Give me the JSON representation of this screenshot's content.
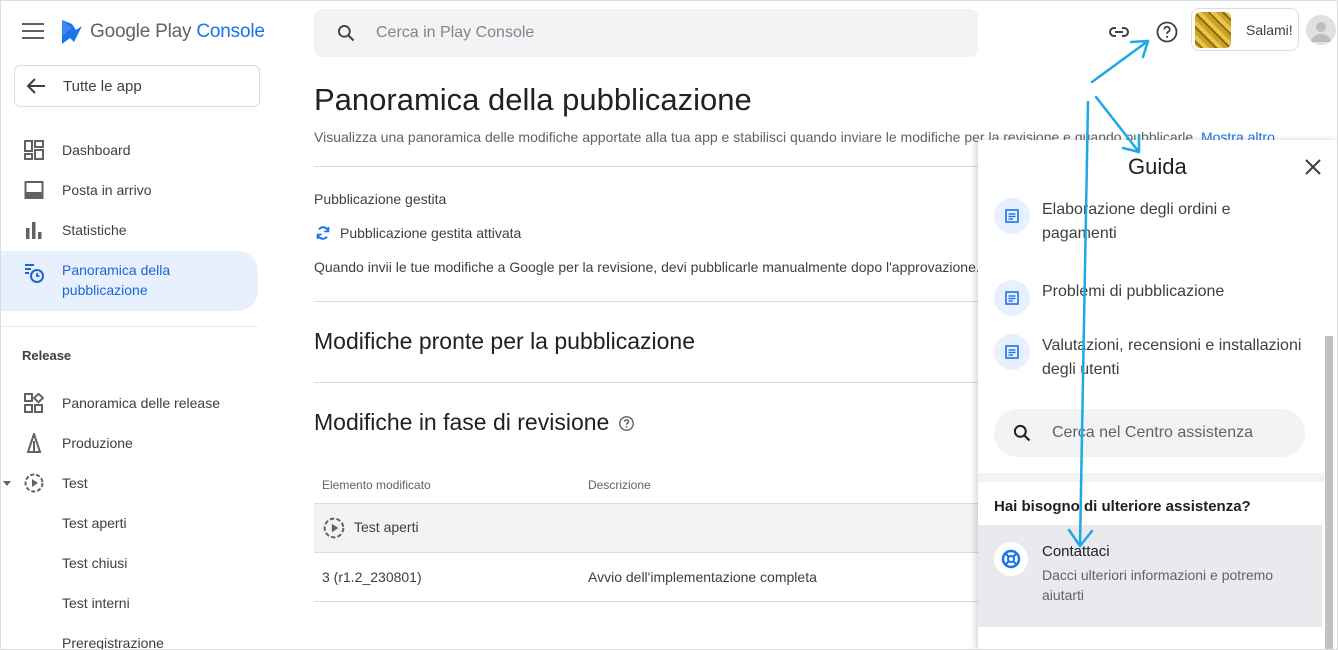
{
  "header": {
    "logo_prefix": "Google Play",
    "logo_suffix": "Console",
    "search_placeholder": "Cerca in Play Console",
    "account_name": "Salami!"
  },
  "sidebar": {
    "all_apps": "Tutte le app",
    "items": [
      {
        "label": "Dashboard",
        "icon": "dashboard-icon"
      },
      {
        "label": "Posta in arrivo",
        "icon": "inbox-icon"
      },
      {
        "label": "Statistiche",
        "icon": "bar-chart-icon"
      },
      {
        "label": "Panoramica della pubblicazione",
        "icon": "publishing-icon"
      }
    ],
    "release_section": "Release",
    "release_items": [
      {
        "label": "Panoramica delle release",
        "icon": "release-overview-icon"
      },
      {
        "label": "Produzione",
        "icon": "production-icon"
      },
      {
        "label": "Test",
        "icon": "test-icon"
      }
    ],
    "test_subitems": [
      "Test aperti",
      "Test chiusi",
      "Test interni",
      "Preregistrazione"
    ]
  },
  "main": {
    "title": "Panoramica della pubblicazione",
    "description": "Visualizza una panoramica delle modifiche apportate alla tua app e stabilisci quando inviare le modifiche per la revisione e quando pubblicarle.",
    "show_more": "Mostra altro",
    "managed_heading": "Pubblicazione gestita",
    "managed_status": "Pubblicazione gestita attivata",
    "managed_note": "Quando invii le tue modifiche a Google per la revisione, devi pubblicarle manualmente dopo l'approvazione.",
    "ready_heading": "Modifiche pronte per la pubblicazione",
    "review_heading": "Modifiche in fase di revisione",
    "table": {
      "headers": [
        "Elemento modificato",
        "Descrizione"
      ],
      "group_label": "Test aperti",
      "rows": [
        {
          "item": "3 (r1.2_230801)",
          "description": "Avvio dell'implementazione completa"
        }
      ]
    }
  },
  "help": {
    "title": "Guida",
    "articles": [
      "Elaborazione degli ordini e pagamenti",
      "Problemi di pubblicazione",
      "Valutazioni, recensioni e installazioni degli utenti"
    ],
    "search_placeholder": "Cerca nel Centro assistenza",
    "more_help": "Hai bisogno di ulteriore assistenza?",
    "contact_title": "Contattaci",
    "contact_desc": "Dacci ulteriori informazioni e potremo aiutarti"
  },
  "colors": {
    "accent": "#1a73e8",
    "active_bg": "#e8f0fe",
    "annotation_arrow": "#1ea8e6"
  }
}
